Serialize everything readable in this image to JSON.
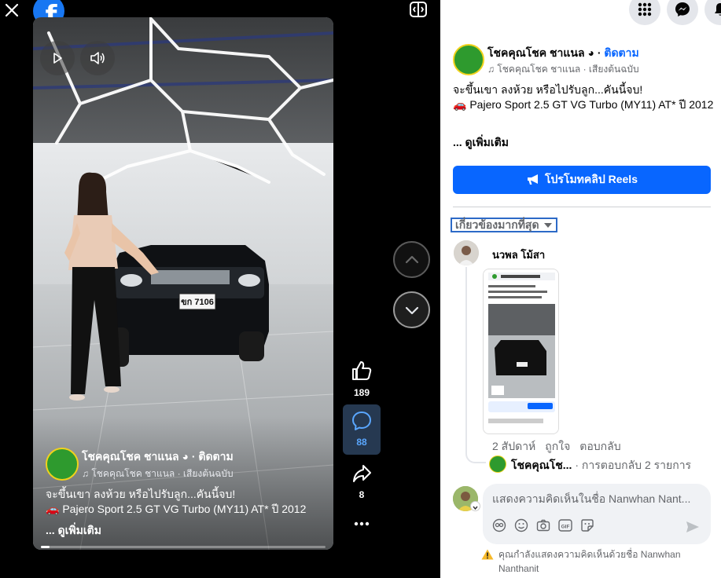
{
  "left": {
    "logo_letter": "f",
    "video": {
      "page_name": "โชคคุณโชค ชาแนล",
      "follow_sep": "·",
      "follow_label": "ติดตาม",
      "audio_line": "โชคคุณโชค ชาแนล · เสียงต้นฉบับ",
      "caption_line1": "จะขึ้นเขา ลงห้วย หรือไปรับลูก...คันนี้จบ!",
      "caption_line2": "Pajero Sport 2.5 GT VG Turbo (MY11) AT* ปี 2012",
      "see_more": "... ดูเพิ่มเติม",
      "plate_text": "ขก 7106",
      "progress_fraction": 0.03
    },
    "actions": {
      "likes": "189",
      "comments": "88",
      "shares": "8"
    }
  },
  "right": {
    "page_name": "โชคคุณโชค ชาแนล",
    "follow_sep": "·",
    "follow_label": "ติดตาม",
    "audio_line": "โชคคุณโชค ชาแนล · เสียงต้นฉบับ",
    "caption_line1": "จะขึ้นเขา ลงห้วย หรือไปรับลูก...คันนี้จบ!",
    "caption_line2": "Pajero Sport 2.5 GT VG Turbo (MY11) AT* ปี 2012",
    "see_more": "... ดูเพิ่มเติม",
    "promote_label": "โปรโมทคลิป Reels",
    "sort_label": "เกี่ยวข้องมากที่สุด",
    "comment": {
      "author": "นวพล โม้สา",
      "time": "2 สัปดาห์",
      "like_label": "ถูกใจ",
      "reply_label": "ตอบกลับ",
      "reply_author": "โชคคุณโช...",
      "reply_count": "· การตอบกลับ 2 รายการ"
    },
    "composer": {
      "placeholder": "แสดงความคิดเห็นในชื่อ Nanwhan Nant..."
    },
    "warning": "คุณกำลังแสดงความคิดเห็นด้วยชื่อ Nanwhan Nanthanit"
  },
  "colors": {
    "brand": "#1877f2",
    "primary_button": "#0866ff",
    "comment_active_bg": "#263951",
    "comment_active_text": "#5aa7ff",
    "warning": "#f7b928"
  }
}
